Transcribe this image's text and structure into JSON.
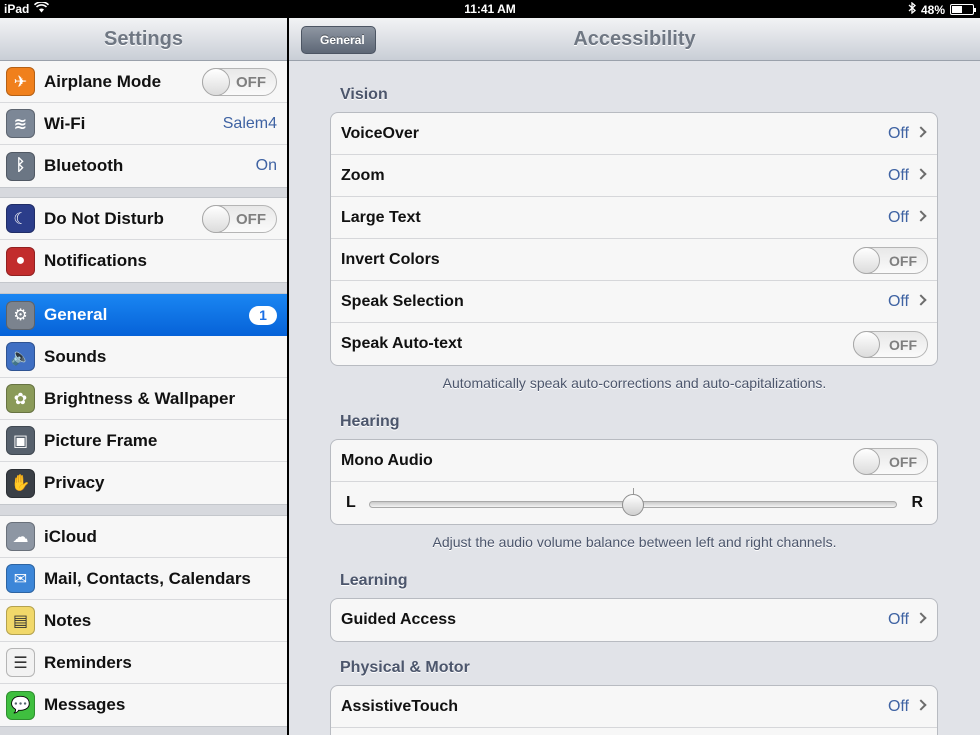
{
  "status_bar": {
    "device": "iPad",
    "time": "11:41 AM",
    "battery": "48%",
    "battery_level": 0.48
  },
  "master": {
    "title": "Settings",
    "groups": [
      [
        {
          "label": "Airplane Mode",
          "icon": "airplane-icon",
          "switch": "OFF",
          "color": "#f0801c"
        },
        {
          "label": "Wi-Fi",
          "icon": "wifi-icon",
          "value": "Salem4",
          "color": "#7c8796"
        },
        {
          "label": "Bluetooth",
          "icon": "bluetooth-icon",
          "value": "On",
          "color": "#6b7684"
        }
      ],
      [
        {
          "label": "Do Not Disturb",
          "icon": "moon-icon",
          "switch": "OFF",
          "color": "#2b3d8a"
        },
        {
          "label": "Notifications",
          "icon": "notifications-icon",
          "color": "#c22d2d"
        }
      ],
      [
        {
          "label": "General",
          "icon": "gear-icon",
          "badge": "1",
          "selected": true,
          "color": "#7b838e"
        },
        {
          "label": "Sounds",
          "icon": "speaker-icon",
          "color": "#3f6fc3"
        },
        {
          "label": "Brightness & Wallpaper",
          "icon": "flower-icon",
          "color": "#8a9a59"
        },
        {
          "label": "Picture Frame",
          "icon": "picture-frame-icon",
          "color": "#56606c"
        },
        {
          "label": "Privacy",
          "icon": "hand-icon",
          "color": "#3a3f46"
        }
      ],
      [
        {
          "label": "iCloud",
          "icon": "cloud-icon",
          "color": "#8d96a3"
        },
        {
          "label": "Mail, Contacts, Calendars",
          "icon": "mail-icon",
          "color": "#3c86d8"
        },
        {
          "label": "Notes",
          "icon": "notes-icon",
          "color": "#f1d86a"
        },
        {
          "label": "Reminders",
          "icon": "reminders-icon",
          "color": "#f2f2f2"
        },
        {
          "label": "Messages",
          "icon": "messages-icon",
          "color": "#3fbf3f"
        }
      ]
    ]
  },
  "detail": {
    "back_label": "General",
    "title": "Accessibility",
    "vision": {
      "title": "Vision",
      "rows": [
        {
          "label": "VoiceOver",
          "value": "Off",
          "kind": "disclosure"
        },
        {
          "label": "Zoom",
          "value": "Off",
          "kind": "disclosure"
        },
        {
          "label": "Large Text",
          "value": "Off",
          "kind": "disclosure"
        },
        {
          "label": "Invert Colors",
          "value": "OFF",
          "kind": "switch"
        },
        {
          "label": "Speak Selection",
          "value": "Off",
          "kind": "disclosure"
        },
        {
          "label": "Speak Auto-text",
          "value": "OFF",
          "kind": "switch"
        }
      ],
      "footer": "Automatically speak auto-corrections and auto-capitalizations."
    },
    "hearing": {
      "title": "Hearing",
      "mono_label": "Mono Audio",
      "mono_value": "OFF",
      "balance_left": "L",
      "balance_right": "R",
      "balance_level": 0.5,
      "footer": "Adjust the audio volume balance between left and right channels."
    },
    "learning": {
      "title": "Learning",
      "guided_label": "Guided Access",
      "guided_value": "Off"
    },
    "physical": {
      "title": "Physical & Motor",
      "assistive_label": "AssistiveTouch",
      "assistive_value": "Off"
    }
  }
}
